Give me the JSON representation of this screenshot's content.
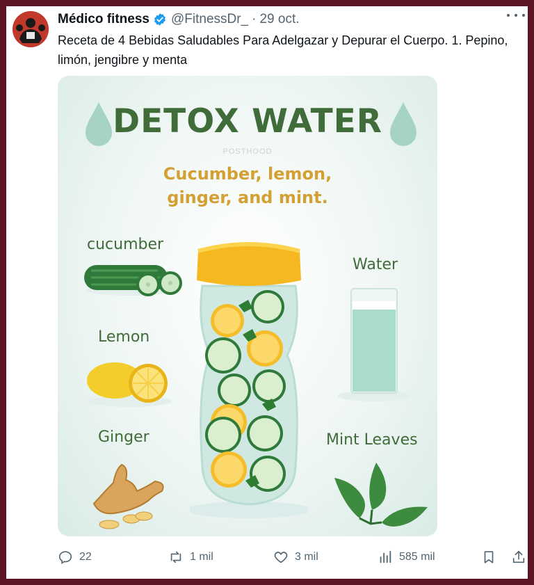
{
  "tweet": {
    "author_name": "Médico fitness",
    "handle": "@FitnessDr_",
    "separator": "·",
    "date": "29 oct.",
    "text": "Receta de 4 Bebidas Saludables Para Adelgazar y Depurar el Cuerpo. 1. Pepino, limón, jengibre y menta"
  },
  "poster": {
    "title": "DETOX WATER",
    "watermark": "POSTHOOD",
    "subtitle_line1": "Cucumber, lemon,",
    "subtitle_line2": "ginger, and mint.",
    "ingredients": {
      "cucumber": "cucumber",
      "lemon": "Lemon",
      "ginger": "Ginger",
      "water": "Water",
      "mint": "Mint Leaves"
    }
  },
  "actions": {
    "replies": "22",
    "reposts": "1 mil",
    "likes": "3 mil",
    "views": "585 mil"
  },
  "icons": {
    "verified": "verified-badge-icon",
    "more": "more-icon",
    "reply": "reply-icon",
    "repost": "repost-icon",
    "like": "heart-icon",
    "views": "views-icon",
    "bookmark": "bookmark-icon",
    "share": "share-icon"
  },
  "colors": {
    "frame": "#5b1524",
    "verified": "#1d9bf0",
    "poster_title": "#3f6c39",
    "poster_subtitle": "#d3a033"
  }
}
